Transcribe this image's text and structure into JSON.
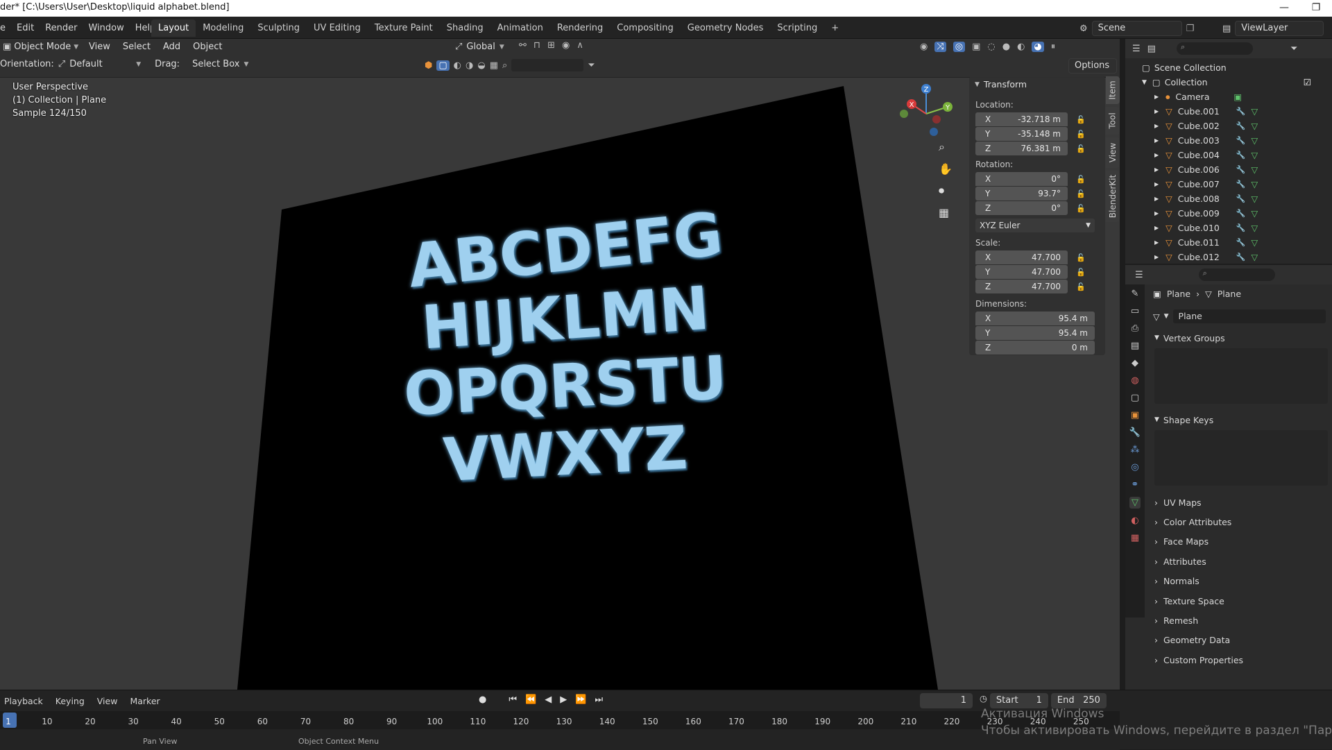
{
  "window": {
    "title": "der* [C:\\Users\\User\\Desktop\\liquid alphabet.blend]",
    "minimize": "—",
    "maximize": "❐",
    "close": "✕"
  },
  "menubar": {
    "items": [
      "e",
      "Edit",
      "Render",
      "Window",
      "Help"
    ],
    "workspaces": [
      "Layout",
      "Modeling",
      "Sculpting",
      "UV Editing",
      "Texture Paint",
      "Shading",
      "Animation",
      "Rendering",
      "Compositing",
      "Geometry Nodes",
      "Scripting",
      "+"
    ],
    "active_workspace": "Layout",
    "scene": "Scene",
    "view_layer": "ViewLayer"
  },
  "viewport_header": {
    "mode": "Object Mode",
    "menus": [
      "View",
      "Select",
      "Add",
      "Object"
    ],
    "transform_orientation": "Global",
    "orientation_label": "Orientation:",
    "orientation_value": "Default",
    "drag_label": "Drag:",
    "drag_value": "Select Box",
    "options": "Options"
  },
  "viewport": {
    "overlay_lines": [
      "User Perspective",
      "(1) Collection | Plane",
      "Sample 124/150"
    ],
    "alphabet_rows": [
      "ABCDEFG",
      "HIJKLMN",
      "OPQRSTU",
      "VWXYZ"
    ],
    "letter_color": "#9fd0ef",
    "gizmo_axes": {
      "x": "X",
      "y": "Y",
      "z": "Z"
    }
  },
  "n_panel": {
    "header": "Transform",
    "location_label": "Location:",
    "location": [
      {
        "axis": "X",
        "value": "-32.718 m"
      },
      {
        "axis": "Y",
        "value": "-35.148 m"
      },
      {
        "axis": "Z",
        "value": "76.381 m"
      }
    ],
    "rotation_label": "Rotation:",
    "rotation": [
      {
        "axis": "X",
        "value": "0°"
      },
      {
        "axis": "Y",
        "value": "93.7°"
      },
      {
        "axis": "Z",
        "value": "0°"
      }
    ],
    "rotation_mode": "XYZ Euler",
    "scale_label": "Scale:",
    "scale": [
      {
        "axis": "X",
        "value": "47.700"
      },
      {
        "axis": "Y",
        "value": "47.700"
      },
      {
        "axis": "Z",
        "value": "47.700"
      }
    ],
    "dimensions_label": "Dimensions:",
    "dimensions": [
      {
        "axis": "X",
        "value": "95.4 m"
      },
      {
        "axis": "Y",
        "value": "95.4 m"
      },
      {
        "axis": "Z",
        "value": "0 m"
      }
    ],
    "tabs": [
      "Item",
      "Tool",
      "View",
      "BlenderKit"
    ]
  },
  "outliner": {
    "root": "Scene Collection",
    "collection": "Collection",
    "items": [
      "Camera",
      "Cube.001",
      "Cube.002",
      "Cube.003",
      "Cube.004",
      "Cube.006",
      "Cube.007",
      "Cube.008",
      "Cube.009",
      "Cube.010",
      "Cube.011",
      "Cube.012"
    ]
  },
  "properties": {
    "breadcrumb_object": "Plane",
    "breadcrumb_data": "Plane",
    "data_name": "Plane",
    "sections_open": [
      "Vertex Groups",
      "Shape Keys"
    ],
    "sections_closed": [
      "UV Maps",
      "Color Attributes",
      "Face Maps",
      "Attributes",
      "Normals",
      "Texture Space",
      "Remesh",
      "Geometry Data",
      "Custom Properties"
    ]
  },
  "timeline": {
    "menus": [
      "Playback",
      "Keying",
      "View",
      "Marker"
    ],
    "current_frame": "1",
    "start_label": "Start",
    "start": "1",
    "end_label": "End",
    "end": "250",
    "ticks": [
      "1",
      "10",
      "20",
      "30",
      "40",
      "50",
      "60",
      "70",
      "80",
      "90",
      "100",
      "110",
      "120",
      "130",
      "140",
      "150",
      "160",
      "170",
      "180",
      "190",
      "200",
      "210",
      "220",
      "230",
      "240",
      "250"
    ],
    "status_left": "Pan View",
    "status_mid": "Object Context Menu"
  },
  "watermark": {
    "line1": "Активация Windows",
    "line2": "Чтобы активировать Windows, перейдите в раздел \"Параметры\"."
  },
  "colors": {
    "accent": "#4772b3",
    "object_orange": "#e8923a",
    "mesh_green": "#5ec36b",
    "modifier_blue": "#6a9bd8"
  }
}
